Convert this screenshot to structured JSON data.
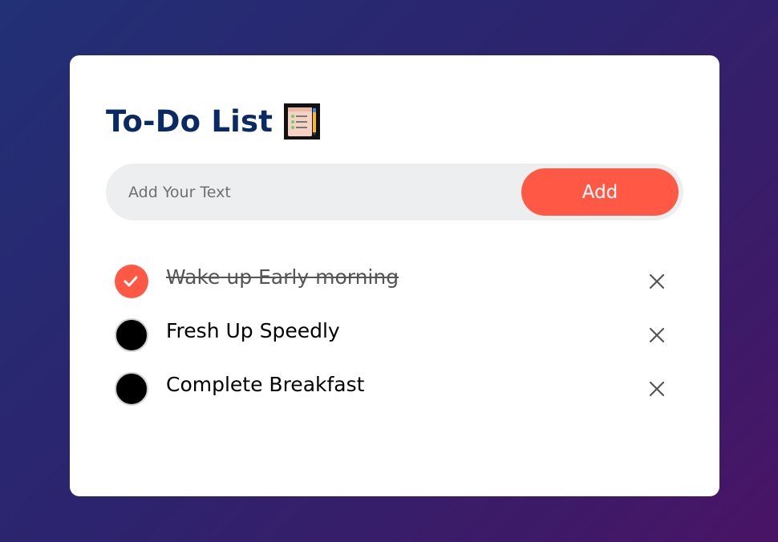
{
  "app": {
    "title": "To-Do List",
    "title_icon": "notepad-checklist-icon"
  },
  "input": {
    "placeholder": "Add Your Text",
    "value": ""
  },
  "add_button": {
    "label": "Add"
  },
  "tasks": [
    {
      "text": "Wake up Early morning",
      "completed": true
    },
    {
      "text": "Fresh Up Speedly",
      "completed": false
    },
    {
      "text": "Complete Breakfast",
      "completed": false
    }
  ],
  "colors": {
    "accent": "#ff5945",
    "title": "#0a2a66",
    "card": "#ffffff",
    "input_bg": "#edeef0",
    "bg_start": "#223075",
    "bg_end": "#4a1466"
  },
  "icons": {
    "checked": "check-icon",
    "delete": "close-icon"
  }
}
